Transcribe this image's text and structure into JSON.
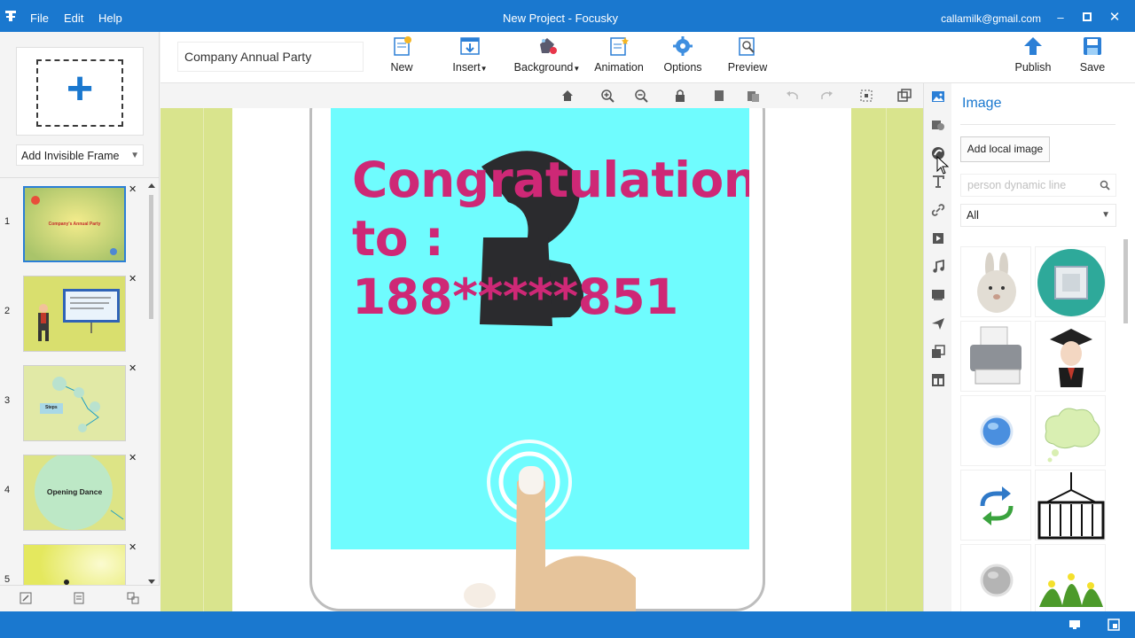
{
  "window": {
    "title": "New Project - Focusky",
    "account": "callamilk@gmail.com",
    "menu": [
      "File",
      "Edit",
      "Help"
    ]
  },
  "left_panel": {
    "add_frame_select": "Add Invisible Frame",
    "thumbnails": [
      {
        "num": "1",
        "caption": "Company's Annual Party",
        "bg": "#e8e07a"
      },
      {
        "num": "2",
        "caption": "",
        "bg": "#d6dd6a"
      },
      {
        "num": "3",
        "caption": "Steps",
        "bg": "#dfe8a0"
      },
      {
        "num": "4",
        "caption": "Opening Dance",
        "bg": "#dde486"
      },
      {
        "num": "5",
        "caption": "",
        "bg": "#e6ea6d"
      }
    ]
  },
  "toolbar": {
    "project_name": "Company Annual Party",
    "buttons": [
      {
        "label": "New",
        "icon": "new-icon"
      },
      {
        "label": "Insert",
        "icon": "insert-icon",
        "dropdown": true
      },
      {
        "label": "Background",
        "icon": "background-icon",
        "dropdown": true
      },
      {
        "label": "Animation",
        "icon": "animation-icon"
      },
      {
        "label": "Options",
        "icon": "options-gear-icon"
      },
      {
        "label": "Preview",
        "icon": "preview-icon"
      },
      {
        "label": "Publish",
        "icon": "publish-icon"
      },
      {
        "label": "Save",
        "icon": "save-icon"
      }
    ]
  },
  "canvas": {
    "slide_text": [
      "Congratulations",
      "to :",
      "188*****851"
    ],
    "screen_color": "#6ffcfe",
    "text_color": "#ce2876"
  },
  "right_panel": {
    "title": "Image",
    "add_local_label": "Add local image",
    "search_placeholder": "person dynamic line",
    "filter_value": "All",
    "images": [
      "rabbit",
      "chip",
      "printer",
      "graduate",
      "globe-button",
      "cloud-bubble",
      "refresh-arrows",
      "cargo-container",
      "silver-button",
      "grass-flowers"
    ]
  },
  "colors": {
    "accent": "#1a78cf",
    "canvas_bg": "#d9e48d"
  }
}
